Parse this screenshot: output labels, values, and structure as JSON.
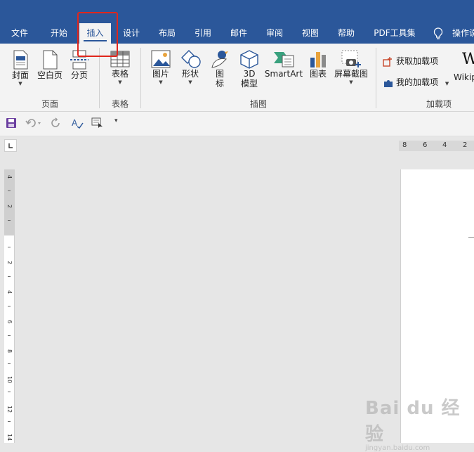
{
  "tabs": [
    "文件",
    "开始",
    "插入",
    "设计",
    "布局",
    "引用",
    "邮件",
    "审阅",
    "视图",
    "帮助",
    "PDF工具集"
  ],
  "active_tab": "插入",
  "tell_me": "操作说",
  "ribbon": {
    "pages": {
      "cover": "封面",
      "blank": "空白页",
      "break": "分页",
      "group": "页面"
    },
    "tables": {
      "table": "表格",
      "group": "表格"
    },
    "illustrations": {
      "pictures": "图片",
      "shapes": "形状",
      "icons_l1": "图",
      "icons_l2": "标",
      "models_l1": "3D",
      "models_l2": "模型",
      "smartart": "SmartArt",
      "chart": "图表",
      "screenshot": "屏幕截图",
      "group": "插图"
    },
    "addins": {
      "get": "获取加载项",
      "my": "我的加载项",
      "wiki": "Wikip",
      "group": "加载项"
    }
  },
  "colors": {
    "titlebar": "#2b579a",
    "highlight": "#e0261c"
  },
  "hruler_numbers": [
    "8",
    "6",
    "4",
    "2"
  ],
  "vruler_numbers": [
    "4",
    "2",
    "2",
    "4",
    "6",
    "8",
    "10",
    "12",
    "14"
  ],
  "watermark": {
    "brand": "Bai du 经验",
    "sub": "jingyan.baidu.com"
  }
}
